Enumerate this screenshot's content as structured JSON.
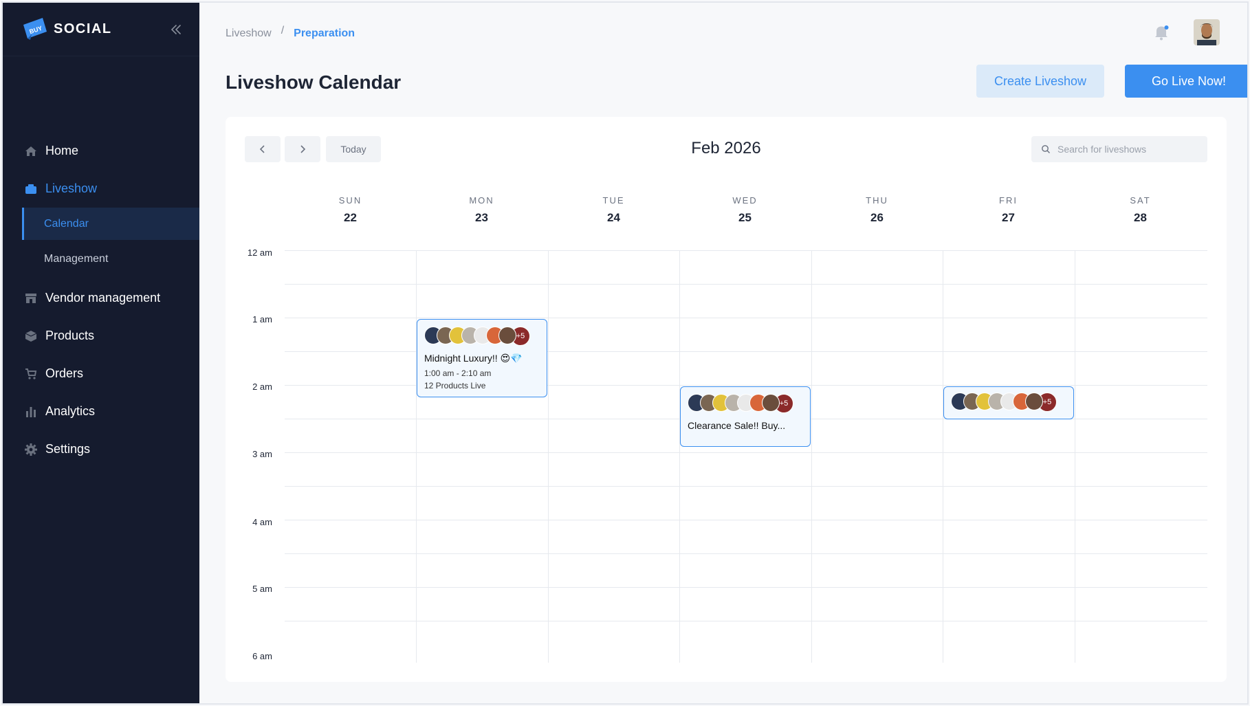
{
  "brand": {
    "name": "SOCIAL",
    "logo_text": "BUY"
  },
  "sidebar": {
    "items": [
      {
        "label": "Home",
        "icon": "home-icon"
      },
      {
        "label": "Liveshow",
        "icon": "liveshow-icon"
      },
      {
        "label": "Vendor management",
        "icon": "store-icon"
      },
      {
        "label": "Products",
        "icon": "box-icon"
      },
      {
        "label": "Orders",
        "icon": "cart-icon"
      },
      {
        "label": "Analytics",
        "icon": "bar-chart-icon"
      },
      {
        "label": "Settings",
        "icon": "gear-icon"
      }
    ],
    "sub_items": [
      {
        "label": "Calendar"
      },
      {
        "label": "Management"
      }
    ]
  },
  "breadcrumb": {
    "root": "Liveshow",
    "separator": "/",
    "current": "Preparation"
  },
  "header": {
    "title": "Liveshow Calendar",
    "create_label": "Create Liveshow",
    "go_live_label": "Go Live Now!"
  },
  "calendar": {
    "today_label": "Today",
    "month_label": "Feb 2026",
    "search_placeholder": "Search for liveshows",
    "days": [
      {
        "name": "SUN",
        "num": "22"
      },
      {
        "name": "MON",
        "num": "23"
      },
      {
        "name": "TUE",
        "num": "24"
      },
      {
        "name": "WED",
        "num": "25"
      },
      {
        "name": "THU",
        "num": "26"
      },
      {
        "name": "FRI",
        "num": "27"
      },
      {
        "name": "SAT",
        "num": "28"
      }
    ],
    "times": [
      "12 am",
      "1 am",
      "2 am",
      "3 am",
      "4 am",
      "5 am",
      "6 am"
    ],
    "events": [
      {
        "title": "Midnight Luxury!! 😍💎",
        "time": "1:00 am - 2:10 am",
        "products": "12 Products Live",
        "more": "+5"
      },
      {
        "title": "Clearance Sale!! Buy...",
        "more": "+5"
      },
      {
        "more": "+5"
      }
    ]
  },
  "colors": {
    "accent": "#3b8ff0",
    "sidebar_bg": "#151b2e",
    "active_bg": "#1a2a48"
  }
}
